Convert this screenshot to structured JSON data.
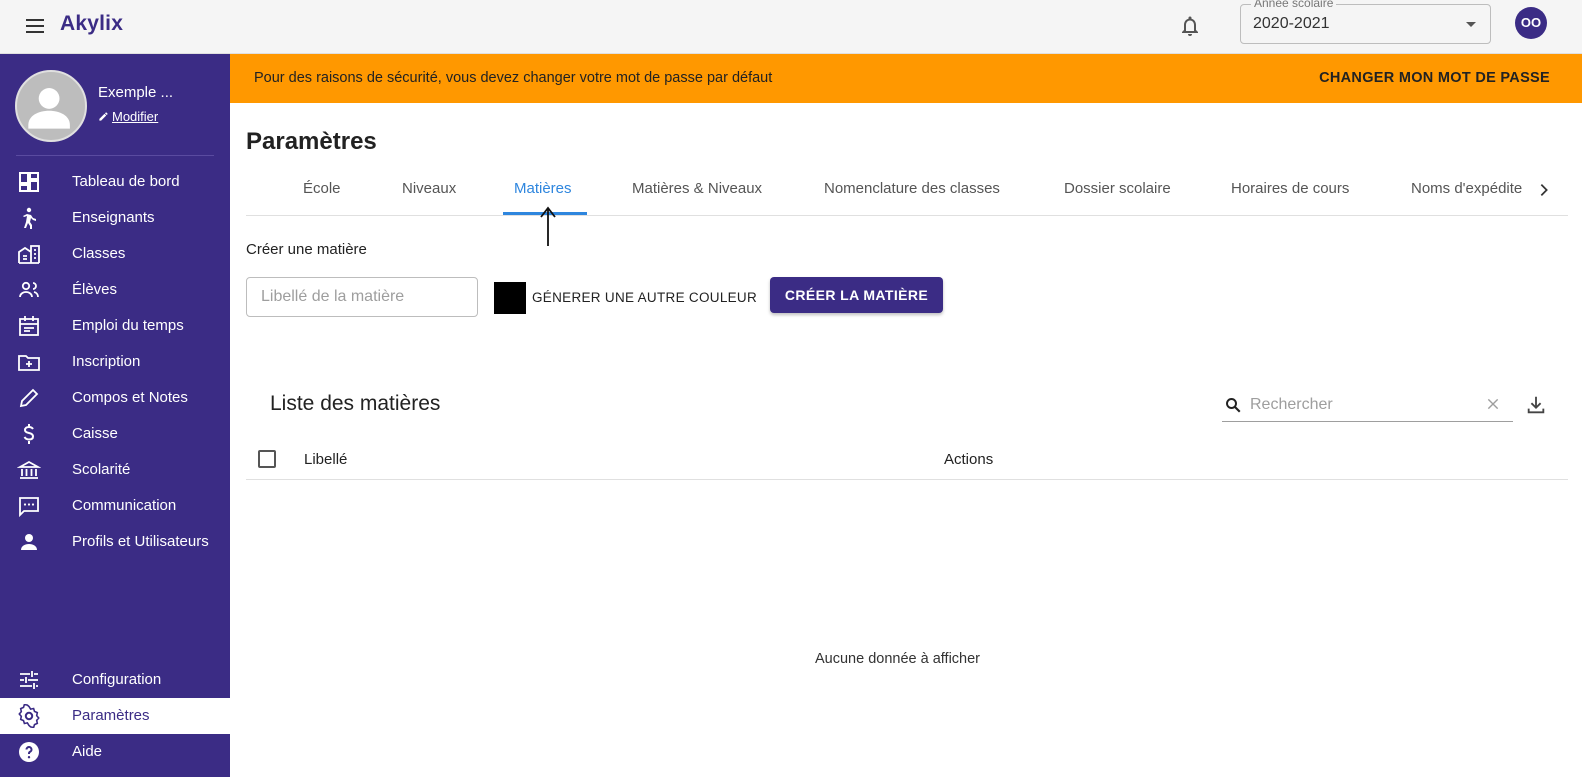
{
  "app": {
    "brand": "Akylix"
  },
  "topbar": {
    "year_label": "Année scolaire",
    "year_value": "2020-2021",
    "user_initials": "OO"
  },
  "profile": {
    "name": "Exemple ...",
    "edit_label": "Modifier"
  },
  "sidebar": {
    "items": [
      {
        "label": "Tableau de bord",
        "icon": "dashboard-icon"
      },
      {
        "label": "Enseignants",
        "icon": "teacher-icon"
      },
      {
        "label": "Classes",
        "icon": "building-icon"
      },
      {
        "label": "Élèves",
        "icon": "people-icon"
      },
      {
        "label": "Emploi du temps",
        "icon": "calendar-icon"
      },
      {
        "label": "Inscription",
        "icon": "folder-add-icon"
      },
      {
        "label": "Compos et Notes",
        "icon": "pencil-icon"
      },
      {
        "label": "Caisse",
        "icon": "dollar-icon"
      },
      {
        "label": "Scolarité",
        "icon": "bank-icon"
      },
      {
        "label": "Communication",
        "icon": "chat-icon"
      },
      {
        "label": "Profils et Utilisateurs",
        "icon": "person-icon"
      }
    ],
    "bottom": [
      {
        "label": "Configuration",
        "icon": "tune-icon",
        "active": false
      },
      {
        "label": "Paramètres",
        "icon": "gear-icon",
        "active": true
      },
      {
        "label": "Aide",
        "icon": "help-icon",
        "active": false
      }
    ]
  },
  "banner": {
    "message": "Pour des raisons de sécurité, vous devez changer votre mot de passe par défaut",
    "action": "CHANGER MON MOT DE PASSE",
    "color": "#ff9800"
  },
  "page": {
    "title": "Paramètres"
  },
  "tabs": [
    {
      "label": "École",
      "active": false
    },
    {
      "label": "Niveaux",
      "active": false
    },
    {
      "label": "Matières",
      "active": true
    },
    {
      "label": "Matières & Niveaux",
      "active": false
    },
    {
      "label": "Nomenclature des classes",
      "active": false
    },
    {
      "label": "Dossier scolaire",
      "active": false
    },
    {
      "label": "Horaires de cours",
      "active": false
    },
    {
      "label": "Noms d'expédite",
      "active": false
    }
  ],
  "create": {
    "heading": "Créer une matière",
    "input_placeholder": "Libellé de la matière",
    "input_value": "",
    "swatch_color": "#000000",
    "generate_color_label": "GÉNERER UNE AUTRE COULEUR",
    "submit_label": "CRÉER LA MATIÈRE"
  },
  "list": {
    "title": "Liste des matières",
    "search_placeholder": "Rechercher",
    "columns": [
      "Libellé",
      "Actions"
    ],
    "rows": [],
    "empty_text": "Aucune donnée à afficher"
  },
  "colors": {
    "primary": "#3b2c85",
    "accent_tab": "#2e86de",
    "warning": "#ff9800"
  }
}
